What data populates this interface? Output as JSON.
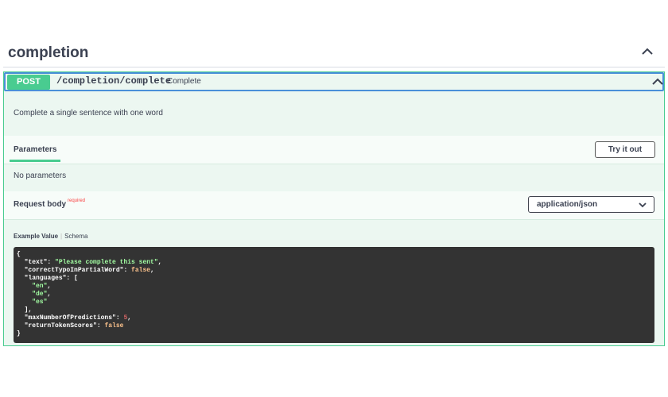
{
  "tag": {
    "title": "completion"
  },
  "operation": {
    "method": "POST",
    "path": "/completion/complete",
    "summary": "Complete",
    "description": "Complete a single sentence with one word"
  },
  "parameters": {
    "tab_label": "Parameters",
    "try_button": "Try it out",
    "empty_text": "No parameters"
  },
  "request_body": {
    "title": "Request body",
    "required_label": "required",
    "content_type": "application/json",
    "example_tab": "Example Value",
    "schema_tab": "Schema",
    "example": {
      "open": "{",
      "close": "}",
      "text_key": "\"text\"",
      "text_value": "\"Please complete this sent\"",
      "typo_key": "\"correctTypoInPartialWord\"",
      "typo_value": "false",
      "languages_key": "\"languages\"",
      "languages_open": "[",
      "lang_1": "\"en\"",
      "lang_2": "\"de\"",
      "lang_3": "\"es\"",
      "languages_close": "],",
      "max_key": "\"maxNumberOfPredictions\"",
      "max_value": "5",
      "scores_key": "\"returnTokenScores\"",
      "scores_value": "false"
    }
  },
  "colors": {
    "post_green": "#49cc90",
    "opblock_bg": "#ecf7f1",
    "focus_blue": "#4a90d9",
    "required_red": "#f93e3e",
    "code_bg": "#333333"
  },
  "icons": {
    "tag_toggle": "chevron-up-icon",
    "summary_toggle": "chevron-up-icon",
    "select_arrow": "chevron-down-icon"
  }
}
